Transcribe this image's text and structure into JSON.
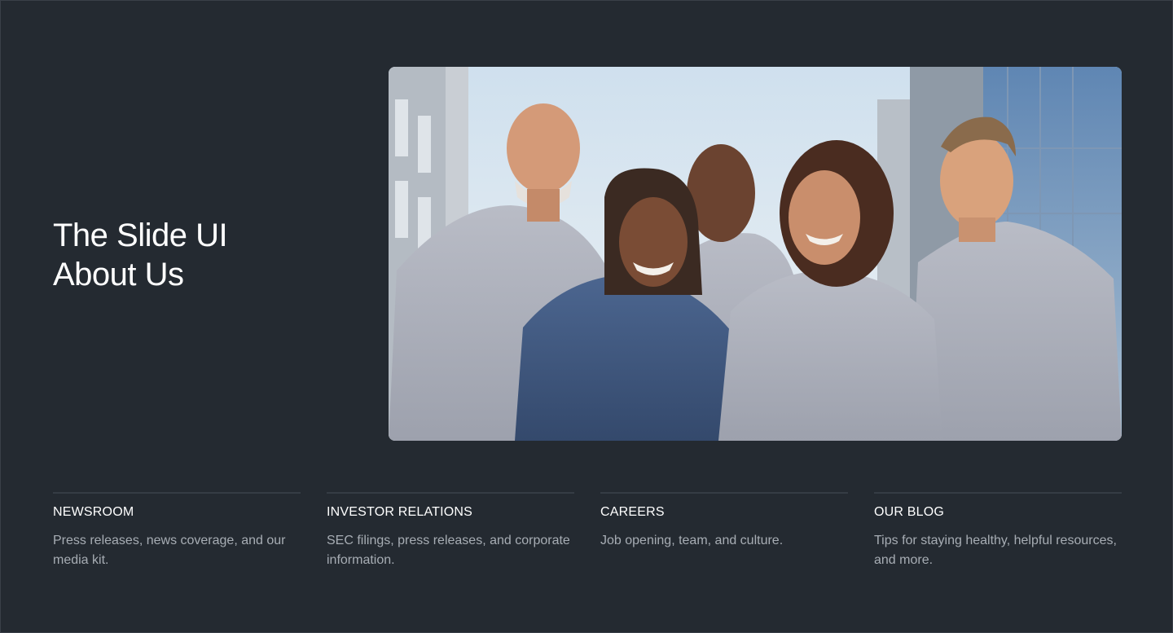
{
  "hero": {
    "title_line1": "The Slide UI",
    "title_line2": "About Us",
    "image_alt": "Team of five smiling people in work shirts standing outdoors in front of city buildings"
  },
  "links": [
    {
      "title": "NEWSROOM",
      "description": "Press releases, news coverage, and our media kit."
    },
    {
      "title": "INVESTOR RELATIONS",
      "description": "SEC filings, press releases, and corporate information."
    },
    {
      "title": "CAREERS",
      "description": "Job opening, team, and culture."
    },
    {
      "title": "OUR BLOG",
      "description": "Tips for staying healthy, helpful resources, and more."
    }
  ],
  "colors": {
    "background": "#242a31",
    "text_primary": "#ffffff",
    "text_secondary": "#a7adb4",
    "divider": "#353c45"
  }
}
